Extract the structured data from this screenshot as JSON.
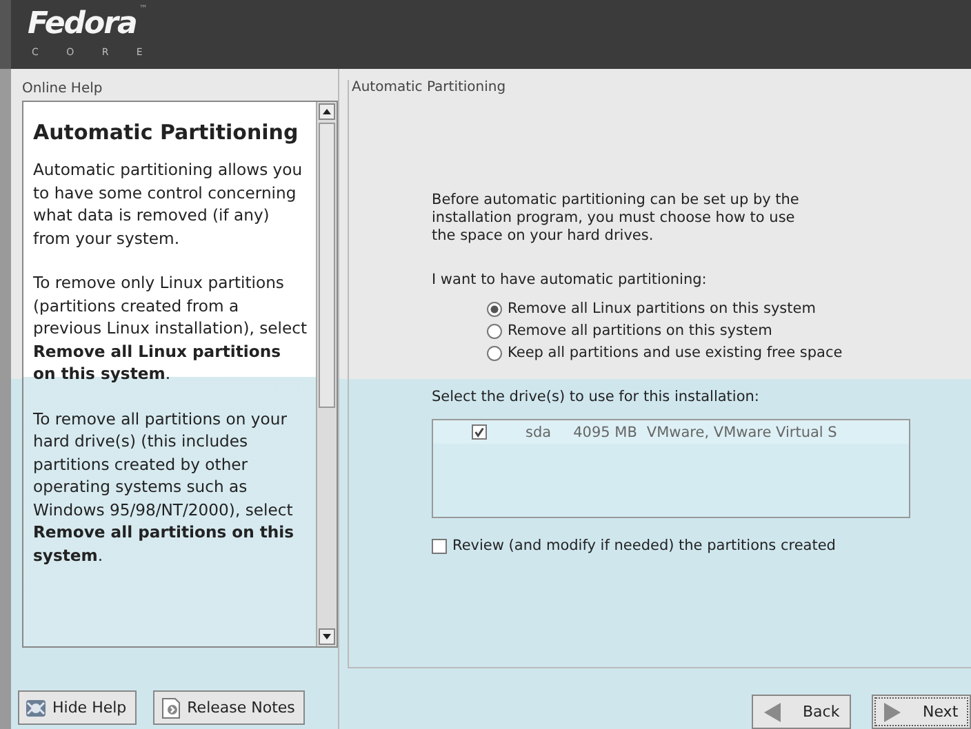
{
  "header": {
    "logo": "Fedora",
    "trademark": "™",
    "sublogo": "C O R E"
  },
  "help": {
    "label": "Online Help",
    "title": "Automatic Partitioning",
    "paragraphs": [
      "Automatic partitioning allows you to have some control concerning what data is removed (if any) from your system.",
      "To remove only Linux partitions (partitions created from a previous Linux installation), select **Remove all Linux partitions on this system**.",
      "To remove all partitions on your hard drive(s) (this includes partitions created by other operating systems such as Windows 95/98/NT/2000), select **Remove all partitions on this system**."
    ]
  },
  "main": {
    "frame_label": "Automatic Partitioning",
    "intro": "Before automatic partitioning can be set up by the installation program, you must choose how to use the space on your hard drives.",
    "choice_label": "I want to have automatic partitioning:",
    "options": [
      {
        "label": "Remove all Linux partitions on this system",
        "selected": true
      },
      {
        "label": "Remove all partitions on this system",
        "selected": false
      },
      {
        "label": "Keep all partitions and use existing free space",
        "selected": false
      }
    ],
    "drives_label": "Select the drive(s) to use for this installation:",
    "drives": [
      {
        "checked": true,
        "name": "sda",
        "size": "4095 MB",
        "model": "VMware, VMware Virtual S"
      }
    ],
    "review": {
      "label": "Review (and modify if needed) the partitions created",
      "checked": false
    }
  },
  "buttons": [
    {
      "kind": "help",
      "label": "Hide Help"
    },
    {
      "kind": "notes",
      "label": "Release Notes"
    },
    {
      "kind": "back",
      "label": "Back"
    },
    {
      "kind": "next",
      "label": "Next"
    }
  ]
}
